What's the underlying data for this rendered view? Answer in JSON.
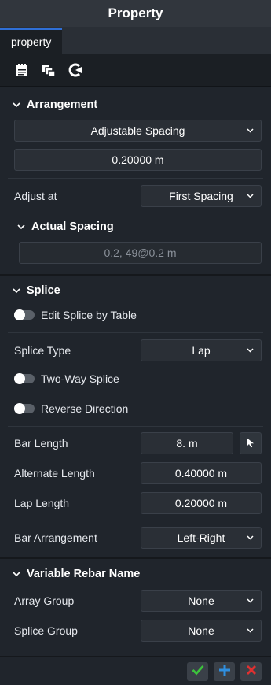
{
  "title": "Property",
  "tab": "property",
  "toolbar": {
    "icons": [
      "clipboard-icon",
      "copy-layers-icon",
      "refresh-c-icon"
    ]
  },
  "arrangement": {
    "header": "Arrangement",
    "method": "Adjustable Spacing",
    "spacing_value": "0.20000 m",
    "adjust_label": "Adjust at",
    "adjust_value": "First Spacing",
    "actual_header": "Actual Spacing",
    "actual_value": "0.2, 49@0.2  m"
  },
  "splice": {
    "header": "Splice",
    "edit_by_table": "Edit Splice by Table",
    "type_label": "Splice Type",
    "type_value": "Lap",
    "two_way": "Two-Way Splice",
    "reverse": "Reverse Direction",
    "bar_length_label": "Bar Length",
    "bar_length_value": "8. m",
    "alternate_label": "Alternate Length",
    "alternate_value": "0.40000 m",
    "lap_label": "Lap Length",
    "lap_value": "0.20000 m",
    "bar_arr_label": "Bar Arrangement",
    "bar_arr_value": "Left-Right"
  },
  "variable": {
    "header": "Variable Rebar Name",
    "array_label": "Array Group",
    "array_value": "None",
    "splice_label": "Splice Group",
    "splice_value": "None"
  },
  "colors": {
    "accent": "#2f6fd6",
    "ok": "#3cc43c",
    "add": "#2f8fe0",
    "cancel": "#e03030"
  }
}
